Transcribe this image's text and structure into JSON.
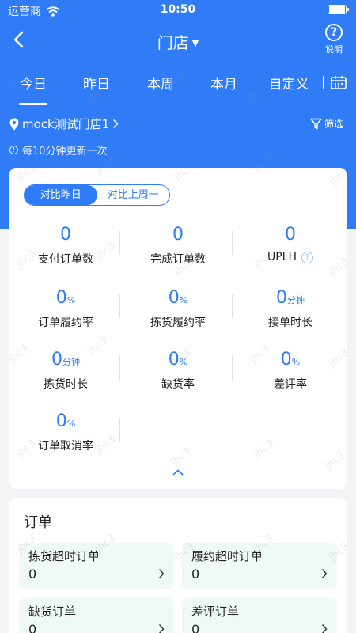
{
  "status_bar": {
    "carrier": "运营商",
    "time": "10:50"
  },
  "nav": {
    "title": "门店",
    "help_label": "说明"
  },
  "tabs": [
    {
      "label": "今日",
      "active": true
    },
    {
      "label": "昨日",
      "active": false
    },
    {
      "label": "本周",
      "active": false
    },
    {
      "label": "本月",
      "active": false
    },
    {
      "label": "自定义",
      "active": false
    }
  ],
  "store": {
    "name": "mock测试门店1",
    "filter_label": "筛选"
  },
  "notice": "每10分钟更新一次",
  "compare": {
    "options": [
      "对比昨日",
      "对比上周一"
    ],
    "selected": "对比昨日"
  },
  "metrics": [
    {
      "value": "0",
      "unit": "",
      "label": "支付订单数"
    },
    {
      "value": "0",
      "unit": "",
      "label": "完成订单数"
    },
    {
      "value": "0",
      "unit": "",
      "label": "UPLH"
    },
    {
      "value": "0",
      "unit": "%",
      "label": "订单履约率"
    },
    {
      "value": "0",
      "unit": "%",
      "label": "拣货履约率"
    },
    {
      "value": "0",
      "unit": "分钟",
      "label": "接单时长"
    },
    {
      "value": "0",
      "unit": "分钟",
      "label": "拣货时长"
    },
    {
      "value": "0",
      "unit": "%",
      "label": "缺货率"
    },
    {
      "value": "0",
      "unit": "%",
      "label": "差评率"
    },
    {
      "value": "0",
      "unit": "%",
      "label": "订单取消率"
    }
  ],
  "orders": {
    "title": "订单",
    "items": [
      {
        "label": "拣货超时订单",
        "value": "0"
      },
      {
        "label": "履约超时订单",
        "value": "0"
      },
      {
        "label": "缺货订单",
        "value": "0"
      },
      {
        "label": "差评订单",
        "value": "0"
      }
    ]
  },
  "watermark": "jhc3",
  "colors": {
    "primary": "#2f7cf6",
    "tile_bg": "#effaf6",
    "page_bg": "#f3f4f6"
  }
}
